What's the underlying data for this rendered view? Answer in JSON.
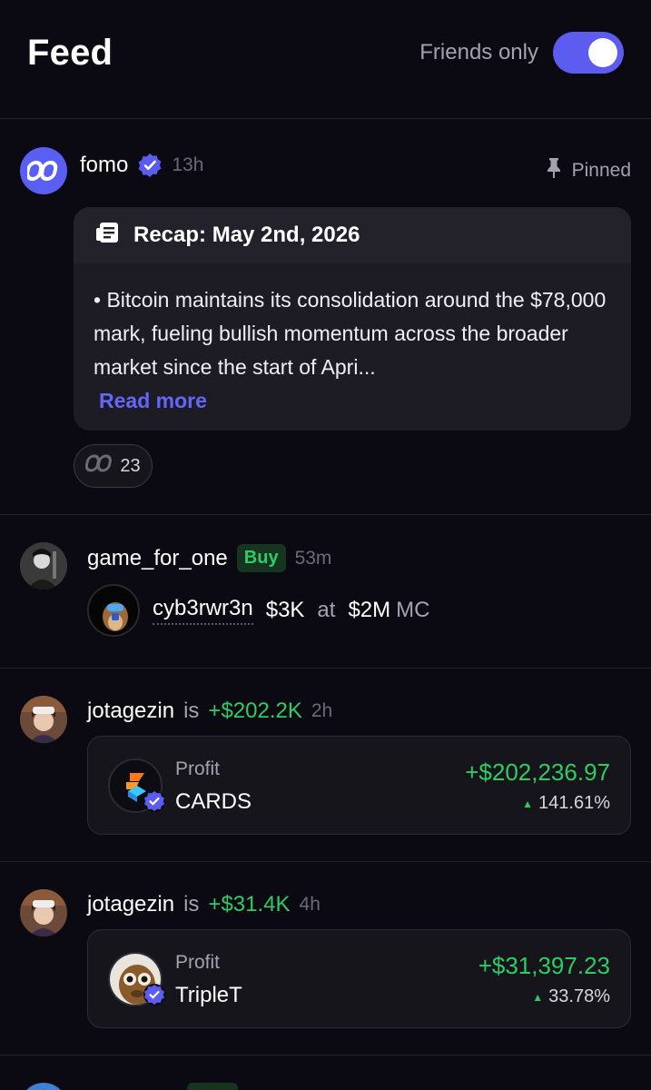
{
  "header": {
    "title": "Feed",
    "toggle_label": "Friends only",
    "toggle_on": true
  },
  "colors": {
    "accent": "#5c5cf0",
    "positive": "#2ecc65",
    "link": "#6466ff",
    "background": "#0b0a12"
  },
  "posts": [
    {
      "username": "fomo",
      "verified": true,
      "time": "13h",
      "pinned_label": "Pinned",
      "recap_title": "Recap: May 2nd, 2026",
      "recap_text": "• Bitcoin maintains its consolidation around the $78,000 mark, fueling bullish momentum across the broader market since the start of Apri...",
      "read_more": "Read more",
      "reaction_count": "23"
    },
    {
      "username": "game_for_one",
      "badge": "Buy",
      "time": "53m",
      "token_name": "cyb3rwr3n",
      "amount": "$3K",
      "at_label": "at",
      "mc_value": "$2M",
      "mc_label": "MC"
    },
    {
      "username": "jotagezin",
      "is_label": "is",
      "gain": "+$202.2K",
      "time": "2h",
      "card": {
        "label": "Profit",
        "token": "CARDS",
        "amount": "+$202,236.97",
        "percent": "141.61%"
      }
    },
    {
      "username": "jotagezin",
      "is_label": "is",
      "gain": "+$31.4K",
      "time": "4h",
      "card": {
        "label": "Profit",
        "token": "TripleT",
        "amount": "+$31,397.23",
        "percent": "33.78%"
      }
    }
  ]
}
